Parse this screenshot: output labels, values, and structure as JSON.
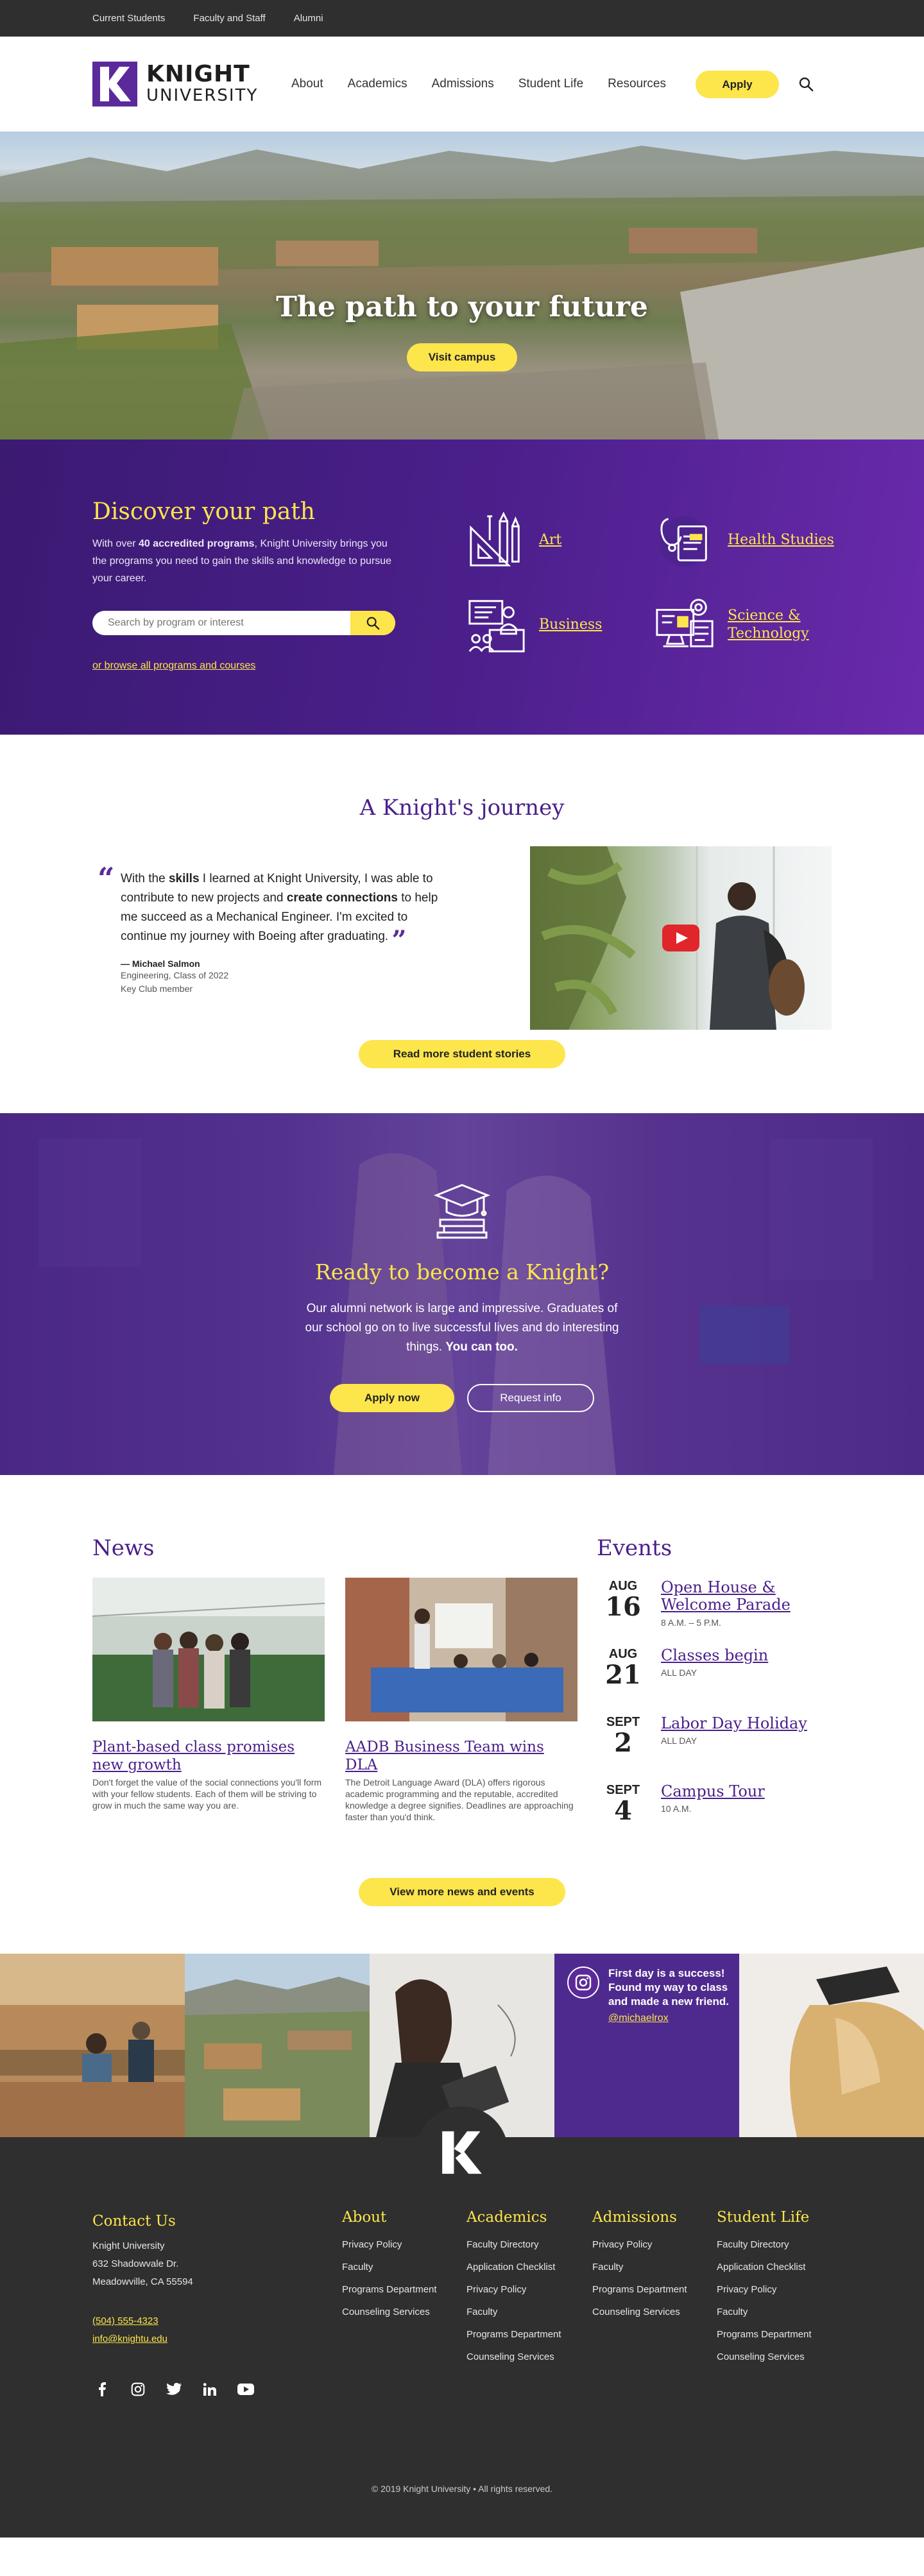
{
  "util_nav": [
    "Current Students",
    "Faculty and Staff",
    "Alumni"
  ],
  "logo": {
    "line1": "KNIGHT",
    "line2": "UNIVERSITY",
    "mark": "K"
  },
  "nav": [
    "About",
    "Academics",
    "Admissions",
    "Student Life",
    "Resources"
  ],
  "header": {
    "apply_label": "Apply",
    "search_icon": "search-icon"
  },
  "hero": {
    "title": "The path to your future",
    "button": "Visit campus"
  },
  "discover": {
    "title": "Discover your path",
    "text_pre": "With over ",
    "text_bold": "40 accredited programs",
    "text_post": ", Knight University brings you the programs you need to gain the skills and knowledge to pursue your career.",
    "search_placeholder": "Search by program or interest",
    "browse_link": "or browse all programs and courses",
    "programs": [
      {
        "label": "Art",
        "icon": "art-icon"
      },
      {
        "label": "Health Studies",
        "icon": "health-icon"
      },
      {
        "label": "Business",
        "icon": "business-icon"
      },
      {
        "label": "Science & Technology",
        "icon": "science-icon"
      }
    ]
  },
  "journey": {
    "title": "A Knight's journey",
    "q1": "With the ",
    "q2": "skills",
    "q3": " I learned at Knight University, I was able to contribute to new projects and ",
    "q4": "create connections",
    "q5": " to help me succeed as a Mechanical Engineer. I'm excited to continue my journey with Boeing after graduating.",
    "author": "— Michael Salmon",
    "meta1": "Engineering, Class of 2022",
    "meta2": "Key Club member",
    "button": "Read more student stories"
  },
  "become": {
    "title": "Ready to become a Knight?",
    "text": "Our alumni network is large and impressive. Graduates of our school go on to live successful lives and do interesting things.",
    "text_bold": "You can too.",
    "apply": "Apply now",
    "info": "Request info"
  },
  "news": {
    "heading": "News",
    "items": [
      {
        "title": "Plant-based class promises new growth",
        "text": "Don't forget the value of the social connections you'll form with your fellow students. Each of them will be striving to grow in much the same way you are."
      },
      {
        "title": "AADB Business Team wins DLA",
        "text": "The Detroit Language Award (DLA) offers rigorous academic programming and the reputable, accredited knowledge a degree signifies. Deadlines are approaching faster than you'd think."
      }
    ],
    "button": "View more news and events"
  },
  "events": {
    "heading": "Events",
    "items": [
      {
        "month": "AUG",
        "day": "16",
        "title": "Open House & Welcome Parade",
        "time": "8 A.M. – 5 P.M."
      },
      {
        "month": "AUG",
        "day": "21",
        "title": "Classes begin",
        "time": "ALL DAY"
      },
      {
        "month": "SEPT",
        "day": "2",
        "title": "Labor Day Holiday",
        "time": "ALL DAY"
      },
      {
        "month": "SEPT",
        "day": "4",
        "title": "Campus Tour",
        "time": "10 A.M."
      }
    ]
  },
  "instagram": {
    "text": "First day is a success! Found my way to class and made a new friend.",
    "handle": "@michaelrox"
  },
  "footer": {
    "contact_heading": "Contact Us",
    "address": [
      "Knight University",
      "632 Shadowvale Dr.",
      "Meadowville, CA 55594"
    ],
    "phone": "(504) 555-4323",
    "email": "info@knightu.edu",
    "columns": [
      {
        "heading": "About",
        "links": [
          "Privacy Policy",
          "Faculty",
          "Programs Department",
          "Counseling Services"
        ]
      },
      {
        "heading": "Academics",
        "links": [
          "Faculty Directory",
          "Application Checklist",
          "Privacy Policy",
          "Faculty",
          "Programs Department",
          "Counseling Services"
        ]
      },
      {
        "heading": "Admissions",
        "links": [
          "Privacy Policy",
          "Faculty",
          "Programs Department",
          "Counseling Services"
        ]
      },
      {
        "heading": "Student Life",
        "links": [
          "Faculty Directory",
          "Application Checklist",
          "Privacy Policy",
          "Faculty",
          "Programs Department",
          "Counseling Services"
        ]
      }
    ],
    "socials": [
      "facebook-icon",
      "instagram-icon",
      "twitter-icon",
      "linkedin-icon",
      "youtube-icon"
    ],
    "copyright": "© 2019 Knight University • All rights reserved."
  },
  "colors": {
    "purple": "#4a1f8a",
    "yellow": "#fde54c",
    "dark": "#2f2f2f"
  }
}
